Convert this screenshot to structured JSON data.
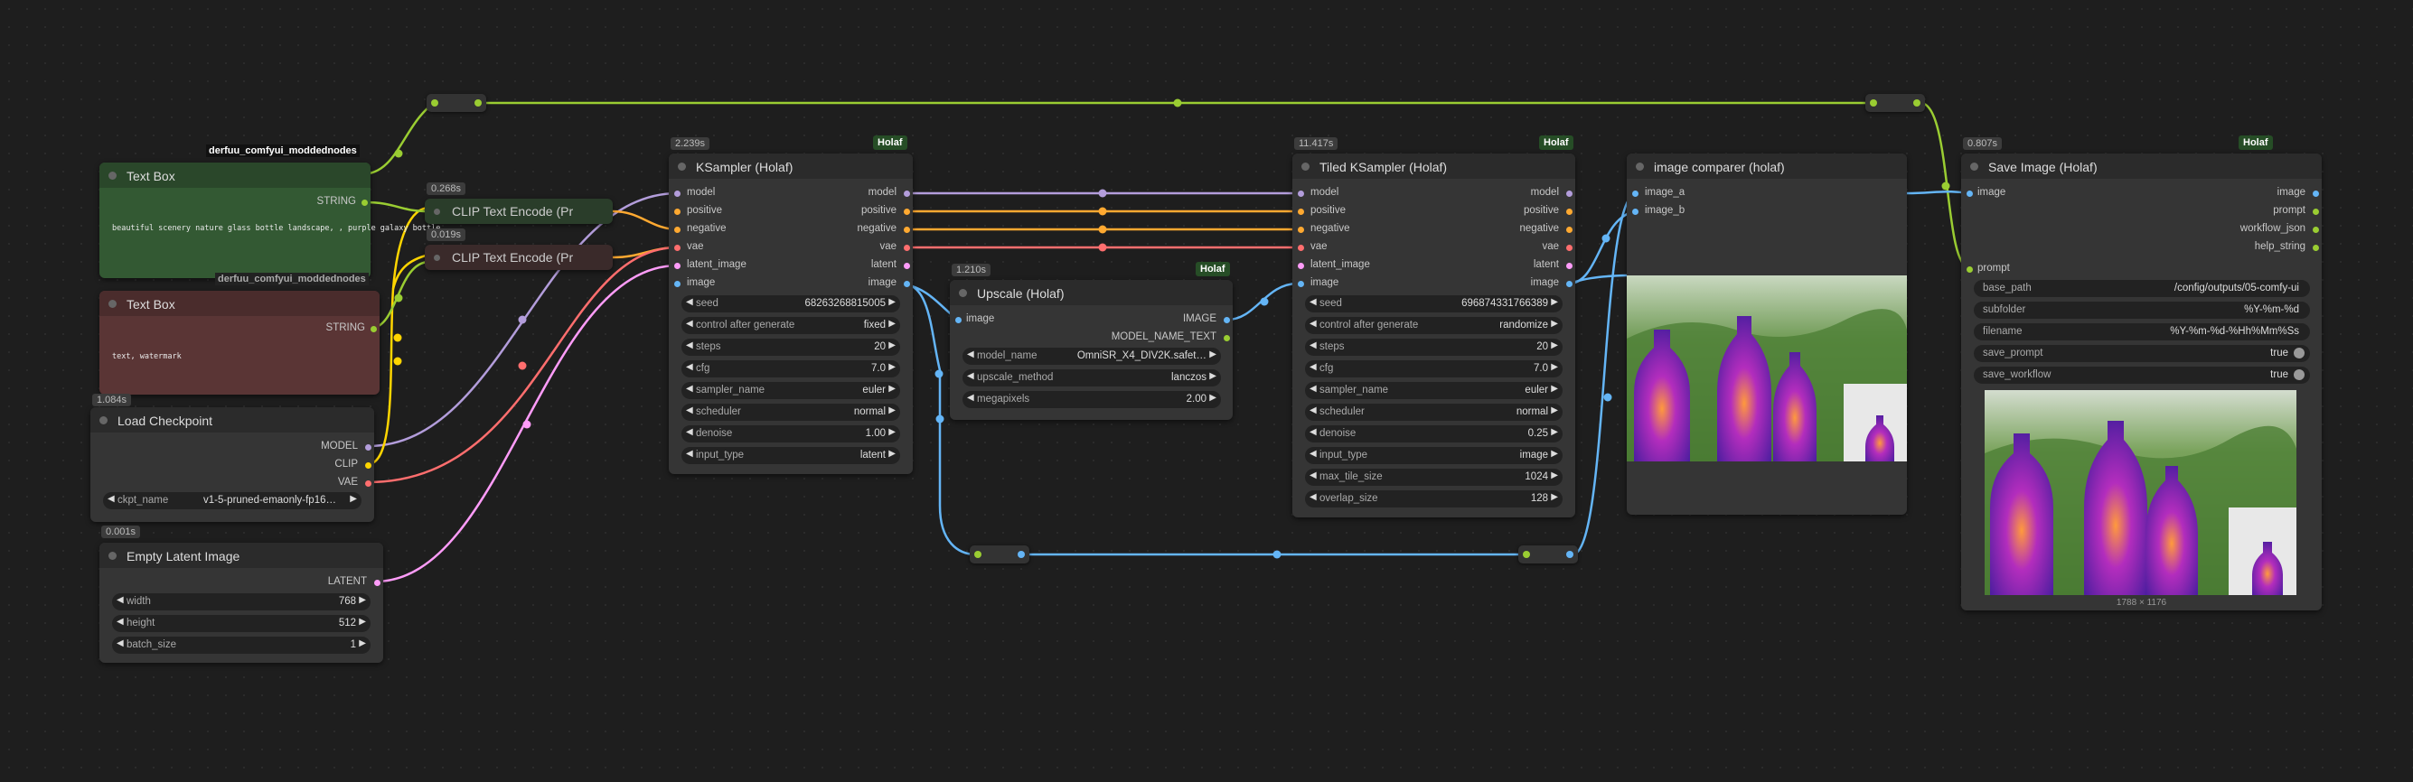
{
  "labels": {
    "moddednodes_1": "derfuu_comfyui_moddednodes",
    "moddednodes_2": "derfuu_comfyui_moddednodes"
  },
  "text_box_1": {
    "title": "Text Box",
    "output": "STRING",
    "text": "beautiful scenery nature glass bottle landscape, , purple galaxy bottle,"
  },
  "text_box_2": {
    "title": "Text Box",
    "output": "STRING",
    "text": "text, watermark"
  },
  "clip_encode_1": {
    "title": "CLIP Text Encode (Pr",
    "time": "0.268s"
  },
  "clip_encode_2": {
    "title": "CLIP Text Encode (Pr",
    "time": "0.019s"
  },
  "load_checkpoint": {
    "title": "Load Checkpoint",
    "time": "1.084s",
    "outputs": [
      "MODEL",
      "CLIP",
      "VAE"
    ],
    "ckpt_label": "ckpt_name",
    "ckpt_value": "v1-5-pruned-emaonly-fp16…"
  },
  "empty_latent": {
    "title": "Empty Latent Image",
    "time": "0.001s",
    "output": "LATENT",
    "widgets": [
      {
        "label": "width",
        "value": "768"
      },
      {
        "label": "height",
        "value": "512"
      },
      {
        "label": "batch_size",
        "value": "1"
      }
    ]
  },
  "ksampler": {
    "title": "KSampler (Holaf)",
    "time": "2.239s",
    "brand": "Holaf",
    "inputs": [
      "model",
      "positive",
      "negative",
      "vae",
      "latent_image",
      "image"
    ],
    "outputs": [
      "model",
      "positive",
      "negative",
      "vae",
      "latent",
      "image"
    ],
    "widgets": [
      {
        "label": "seed",
        "value": "68263268815005"
      },
      {
        "label": "control after generate",
        "value": "fixed"
      },
      {
        "label": "steps",
        "value": "20"
      },
      {
        "label": "cfg",
        "value": "7.0"
      },
      {
        "label": "sampler_name",
        "value": "euler"
      },
      {
        "label": "scheduler",
        "value": "normal"
      },
      {
        "label": "denoise",
        "value": "1.00"
      },
      {
        "label": "input_type",
        "value": "latent"
      }
    ]
  },
  "upscale": {
    "title": "Upscale (Holaf)",
    "time": "1.210s",
    "brand": "Holaf",
    "input": "image",
    "outputs": [
      "IMAGE",
      "MODEL_NAME_TEXT"
    ],
    "widgets": [
      {
        "label": "model_name",
        "value": "OmniSR_X4_DIV2K.safet…"
      },
      {
        "label": "upscale_method",
        "value": "lanczos"
      },
      {
        "label": "megapixels",
        "value": "2.00"
      }
    ]
  },
  "tiled_ksampler": {
    "title": "Tiled KSampler (Holaf)",
    "time": "11.417s",
    "brand": "Holaf",
    "inputs": [
      "model",
      "positive",
      "negative",
      "vae",
      "latent_image",
      "image"
    ],
    "outputs": [
      "model",
      "positive",
      "negative",
      "vae",
      "latent",
      "image"
    ],
    "widgets": [
      {
        "label": "seed",
        "value": "696874331766389"
      },
      {
        "label": "control after generate",
        "value": "randomize"
      },
      {
        "label": "steps",
        "value": "20"
      },
      {
        "label": "cfg",
        "value": "7.0"
      },
      {
        "label": "sampler_name",
        "value": "euler"
      },
      {
        "label": "scheduler",
        "value": "normal"
      },
      {
        "label": "denoise",
        "value": "0.25"
      },
      {
        "label": "input_type",
        "value": "image"
      },
      {
        "label": "max_tile_size",
        "value": "1024"
      },
      {
        "label": "overlap_size",
        "value": "128"
      }
    ]
  },
  "image_comparer": {
    "title": "image comparer (holaf)",
    "inputs": [
      "image_a",
      "image_b"
    ]
  },
  "save_image": {
    "title": "Save Image (Holaf)",
    "time": "0.807s",
    "brand": "Holaf",
    "inputs": [
      "image",
      "prompt"
    ],
    "outputs": [
      "image",
      "prompt",
      "workflow_json",
      "help_string"
    ],
    "widgets": [
      {
        "label": "base_path",
        "value": "/config/outputs/05-comfy-ui"
      },
      {
        "label": "subfolder",
        "value": "%Y-%m-%d"
      },
      {
        "label": "filename",
        "value": "%Y-%m-%d-%Hh%Mm%Ss"
      },
      {
        "label": "save_prompt",
        "value": "true"
      },
      {
        "label": "save_workflow",
        "value": "true"
      }
    ],
    "resolution": "1788 × 1176"
  },
  "colors": {
    "model": "#b39ddb",
    "clip": "#ffd500",
    "conditioning": "#ffa931",
    "vae": "#ff6e6e",
    "latent": "#ff9cf9",
    "image": "#64b5f6",
    "string": "#9acd32",
    "node_bg": "#353535",
    "canvas": "#1e1e1e"
  }
}
